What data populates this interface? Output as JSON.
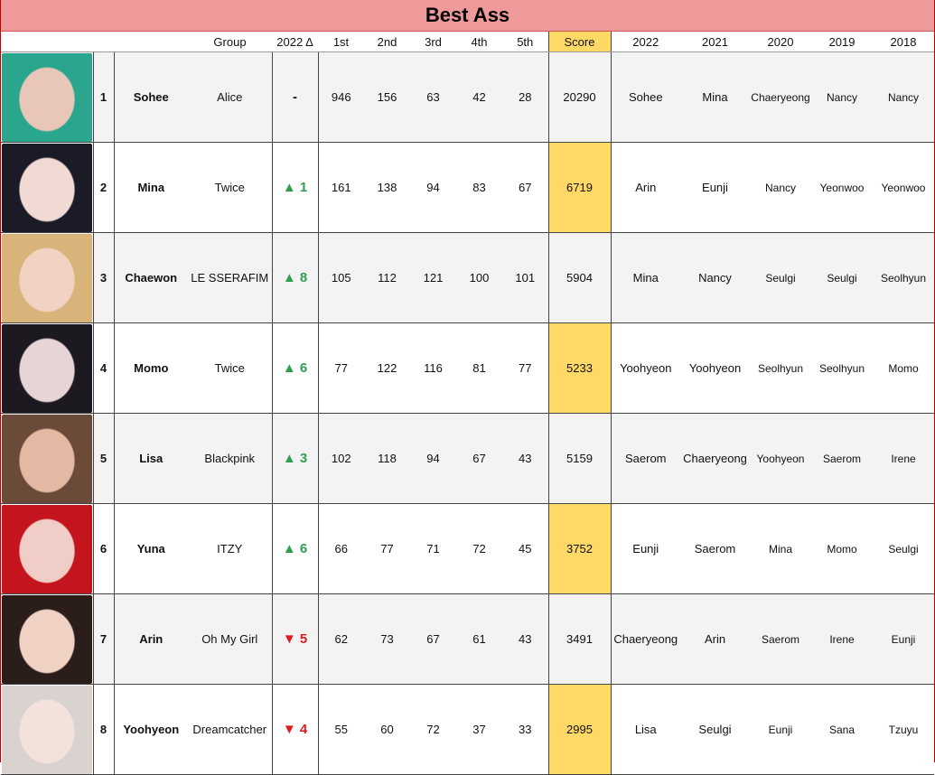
{
  "title": "Best Ass",
  "headers": [
    "",
    "",
    "",
    "Group",
    "2022 Δ",
    "1st",
    "2nd",
    "3rd",
    "4th",
    "5th",
    "Score",
    "2022",
    "2021",
    "2020",
    "2019",
    "2018"
  ],
  "colors": {
    "title_bg": "#ef9a9a",
    "score_bg": "#ffd966",
    "up": "#2e9e4f",
    "down": "#e0191f"
  },
  "rows": [
    {
      "rank": "1",
      "name": "Sohee",
      "group": "Alice",
      "delta": "-",
      "dir": "none",
      "first": "946",
      "second": "156",
      "third": "63",
      "fourth": "42",
      "fifth": "28",
      "score": "20290",
      "y2022": "Sohee",
      "y2021": "Mina",
      "y2020": "Chaeryeong",
      "y2019": "Nancy",
      "y2018": "Nancy",
      "photo_colors": [
        "#2aa58e",
        "#e9c7b8"
      ]
    },
    {
      "rank": "2",
      "name": "Mina",
      "group": "Twice",
      "delta": "▲ 1",
      "dir": "up",
      "first": "161",
      "second": "138",
      "third": "94",
      "fourth": "83",
      "fifth": "67",
      "score": "6719",
      "y2022": "Arin",
      "y2021": "Eunji",
      "y2020": "Nancy",
      "y2019": "Yeonwoo",
      "y2018": "Yeonwoo",
      "photo_colors": [
        "#1b1b28",
        "#f1d9d4"
      ]
    },
    {
      "rank": "3",
      "name": "Chaewon",
      "group": "LE SSERAFIM",
      "delta": "▲ 8",
      "dir": "up",
      "first": "105",
      "second": "112",
      "third": "121",
      "fourth": "100",
      "fifth": "101",
      "score": "5904",
      "y2022": "Mina",
      "y2021": "Nancy",
      "y2020": "Seulgi",
      "y2019": "Seulgi",
      "y2018": "Seolhyun",
      "photo_colors": [
        "#d8b47a",
        "#f2d3c3"
      ]
    },
    {
      "rank": "4",
      "name": "Momo",
      "group": "Twice",
      "delta": "▲ 6",
      "dir": "up",
      "first": "77",
      "second": "122",
      "third": "116",
      "fourth": "81",
      "fifth": "77",
      "score": "5233",
      "y2022": "Yoohyeon",
      "y2021": "Yoohyeon",
      "y2020": "Seolhyun",
      "y2019": "Seolhyun",
      "y2018": "Momo",
      "photo_colors": [
        "#1c1920",
        "#e6d4d6"
      ]
    },
    {
      "rank": "5",
      "name": "Lisa",
      "group": "Blackpink",
      "delta": "▲ 3",
      "dir": "up",
      "first": "102",
      "second": "118",
      "third": "94",
      "fourth": "67",
      "fifth": "43",
      "score": "5159",
      "y2022": "Saerom",
      "y2021": "Chaeryeong",
      "y2020": "Yoohyeon",
      "y2019": "Saerom",
      "y2018": "Irene",
      "photo_colors": [
        "#6b4a3a",
        "#e3b9a3"
      ]
    },
    {
      "rank": "6",
      "name": "Yuna",
      "group": "ITZY",
      "delta": "▲ 6",
      "dir": "up",
      "first": "66",
      "second": "77",
      "third": "71",
      "fourth": "72",
      "fifth": "45",
      "score": "3752",
      "y2022": "Eunji",
      "y2021": "Saerom",
      "y2020": "Mina",
      "y2019": "Momo",
      "y2018": "Seulgi",
      "photo_colors": [
        "#c4141e",
        "#f0cdc6"
      ]
    },
    {
      "rank": "7",
      "name": "Arin",
      "group": "Oh My Girl",
      "delta": "▼ 5",
      "dir": "down",
      "first": "62",
      "second": "73",
      "third": "67",
      "fourth": "61",
      "fifth": "43",
      "score": "3491",
      "y2022": "Chaeryeong",
      "y2021": "Arin",
      "y2020": "Saerom",
      "y2019": "Irene",
      "y2018": "Eunji",
      "photo_colors": [
        "#2a1d1a",
        "#f1d3c6"
      ]
    },
    {
      "rank": "8",
      "name": "Yoohyeon",
      "group": "Dreamcatcher",
      "delta": "▼ 4",
      "dir": "down",
      "first": "55",
      "second": "60",
      "third": "72",
      "fourth": "37",
      "fifth": "33",
      "score": "2995",
      "y2022": "Lisa",
      "y2021": "Seulgi",
      "y2020": "Eunji",
      "y2019": "Sana",
      "y2018": "Tzuyu",
      "photo_colors": [
        "#d9d2cf",
        "#f3e2dc"
      ]
    }
  ]
}
